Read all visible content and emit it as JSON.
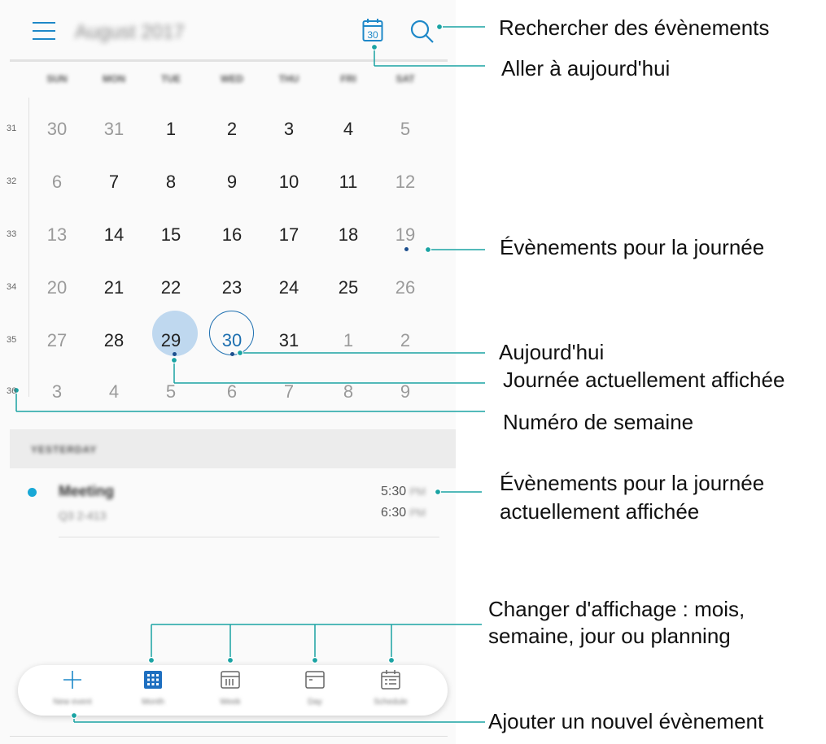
{
  "header": {
    "month_title": "August 2017",
    "today_icon_day": "30"
  },
  "weekdays": [
    "SUN",
    "MON",
    "TUE",
    "WED",
    "THU",
    "FRI",
    "SAT"
  ],
  "weeks": [
    {
      "num": "31",
      "days": [
        {
          "d": "30",
          "dim": true
        },
        {
          "d": "31",
          "dim": true
        },
        {
          "d": "1"
        },
        {
          "d": "2"
        },
        {
          "d": "3"
        },
        {
          "d": "4"
        },
        {
          "d": "5",
          "dim": true
        }
      ]
    },
    {
      "num": "32",
      "days": [
        {
          "d": "6",
          "dim": true
        },
        {
          "d": "7"
        },
        {
          "d": "8"
        },
        {
          "d": "9"
        },
        {
          "d": "10"
        },
        {
          "d": "11"
        },
        {
          "d": "12",
          "dim": true
        }
      ]
    },
    {
      "num": "33",
      "days": [
        {
          "d": "13",
          "dim": true
        },
        {
          "d": "14"
        },
        {
          "d": "15"
        },
        {
          "d": "16"
        },
        {
          "d": "17"
        },
        {
          "d": "18"
        },
        {
          "d": "19",
          "dim": true
        }
      ]
    },
    {
      "num": "34",
      "days": [
        {
          "d": "20",
          "dim": true
        },
        {
          "d": "21"
        },
        {
          "d": "22"
        },
        {
          "d": "23"
        },
        {
          "d": "24"
        },
        {
          "d": "25"
        },
        {
          "d": "26",
          "dim": true
        }
      ]
    },
    {
      "num": "35",
      "days": [
        {
          "d": "27",
          "dim": true
        },
        {
          "d": "28"
        },
        {
          "d": "29"
        },
        {
          "d": "30"
        },
        {
          "d": "31"
        },
        {
          "d": "1",
          "dim": true
        },
        {
          "d": "2",
          "dim": true
        }
      ]
    },
    {
      "num": "36",
      "days": [
        {
          "d": "3",
          "dim": true
        },
        {
          "d": "4",
          "dim": true
        },
        {
          "d": "5",
          "dim": true
        },
        {
          "d": "6",
          "dim": true
        },
        {
          "d": "7",
          "dim": true
        },
        {
          "d": "8",
          "dim": true
        },
        {
          "d": "9",
          "dim": true
        }
      ]
    }
  ],
  "agenda": {
    "section_label": "YESTERDAY",
    "event": {
      "title": "Meeting",
      "subtitle": "Q3 2-413",
      "start": "5:30",
      "end": "6:30",
      "start_suffix": "PM",
      "end_suffix": "PM"
    }
  },
  "bottom_nav": [
    {
      "label": "New event"
    },
    {
      "label": "Month"
    },
    {
      "label": "Week"
    },
    {
      "label": "Day"
    },
    {
      "label": "Schedule"
    }
  ],
  "annotations": {
    "search": "Rechercher des évènements",
    "today": "Aller à aujourd'hui",
    "events_day": "Évènements pour la journée",
    "aujourdhui": "Aujourd'hui",
    "displayed_day": "Journée actuellement affichée",
    "week_number": "Numéro de semaine",
    "events_displayed_1": "Évènements pour la journée",
    "events_displayed_2": "actuellement affichée",
    "change_view_1": "Changer d'affichage : mois,",
    "change_view_2": "semaine, jour ou planning",
    "add_event": "Ajouter un nouvel évènement"
  },
  "colors": {
    "accent": "#1e88c8",
    "callout": "#1aa3a3",
    "selected_bg": "#bfd8ef",
    "event_dot": "#19a8d6"
  }
}
